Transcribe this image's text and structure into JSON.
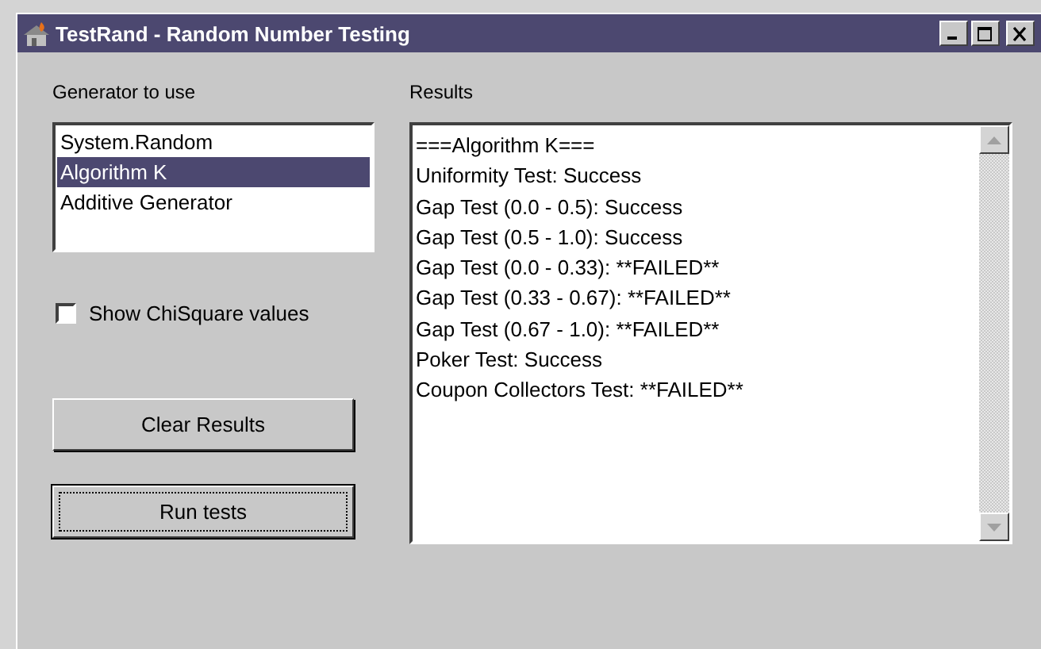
{
  "window": {
    "title": "TestRand - Random Number Testing"
  },
  "generator": {
    "label": "Generator to use",
    "items": [
      {
        "label": "System.Random",
        "selected": false
      },
      {
        "label": "Algorithm K",
        "selected": true
      },
      {
        "label": "Additive Generator",
        "selected": false
      }
    ]
  },
  "checkbox": {
    "label": "Show ChiSquare values",
    "checked": false
  },
  "buttons": [
    {
      "label": "Clear Results",
      "default": false
    },
    {
      "label": "Run tests",
      "default": true
    }
  ],
  "results": {
    "label": "Results",
    "lines": [
      "===Algorithm K===",
      "Uniformity Test: Success",
      "Gap Test (0.0 - 0.5): Success",
      "Gap Test (0.5 - 1.0): Success",
      "Gap Test (0.0 - 0.33): **FAILED**",
      "Gap Test (0.33 - 0.67): **FAILED**",
      "Gap Test (0.67 - 1.0): **FAILED**",
      "Poker Test: Success",
      "Coupon Collectors Test: **FAILED**"
    ]
  }
}
